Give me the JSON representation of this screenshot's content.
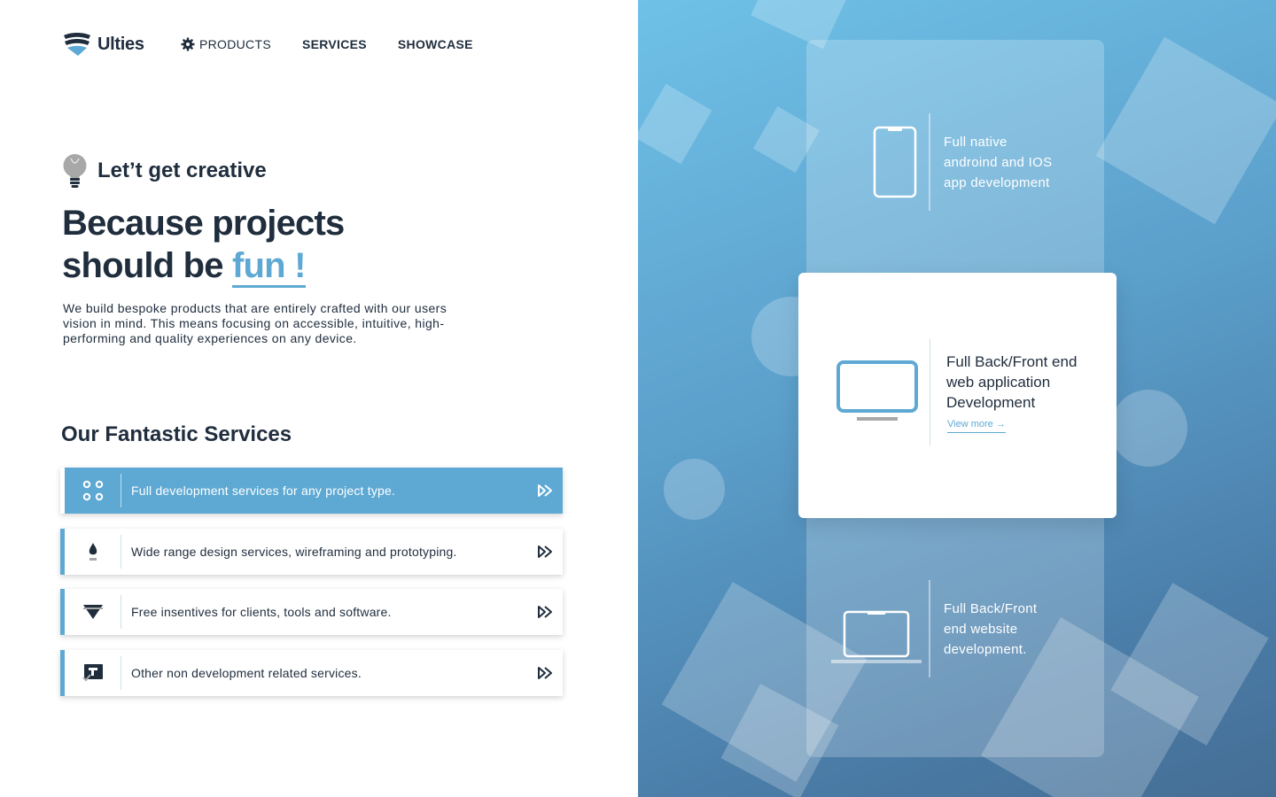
{
  "brand": {
    "name": "Ulties",
    "logo_icon": "layered-shield-logo"
  },
  "nav": {
    "items": [
      {
        "label": "PRODUCTS",
        "icon": "gear-icon"
      },
      {
        "label": "SERVICES"
      },
      {
        "label": "SHOWCASE"
      }
    ]
  },
  "hero": {
    "eyebrow_icon": "lightbulb-icon",
    "eyebrow": "Let’t get creative",
    "headline_line1": "Because projects",
    "headline_line2": "should be",
    "headline_accent": "fun !",
    "intro": "We build bespoke products that are entirely crafted with our users vision in mind. This means focusing on accessible, intuitive, high-performing and quality experiences on any device."
  },
  "services": {
    "title": "Our Fantastic Services",
    "items": [
      {
        "label": "Full development services for any project type.",
        "icon": "four-circles-icon",
        "active": true
      },
      {
        "label": "Wide range design services, wireframing and prototyping.",
        "icon": "pen-nib-icon",
        "active": false
      },
      {
        "label": "Free insentives for clients, tools and software.",
        "icon": "diamond-icon",
        "active": false
      },
      {
        "label": "Other non development related services.",
        "icon": "presentation-icon",
        "active": false
      }
    ]
  },
  "features": {
    "mobile": {
      "text_line1": "Full native",
      "text_line2": "androind and IOS",
      "text_line3": "app development",
      "icon": "smartphone-icon"
    },
    "web": {
      "text_line1": "Full Back/Front end",
      "text_line2": "web application",
      "text_line3": "Development",
      "link": "View more →",
      "icon": "monitor-icon"
    },
    "website": {
      "text_line1": "Full Back/Front",
      "text_line2": "end website",
      "text_line3": "development.",
      "icon": "laptop-icon"
    }
  },
  "colors": {
    "accent": "#5ea9d3",
    "text": "#1f2d3d",
    "panel_top": "#6fc1e8",
    "panel_bottom": "#456e95"
  }
}
